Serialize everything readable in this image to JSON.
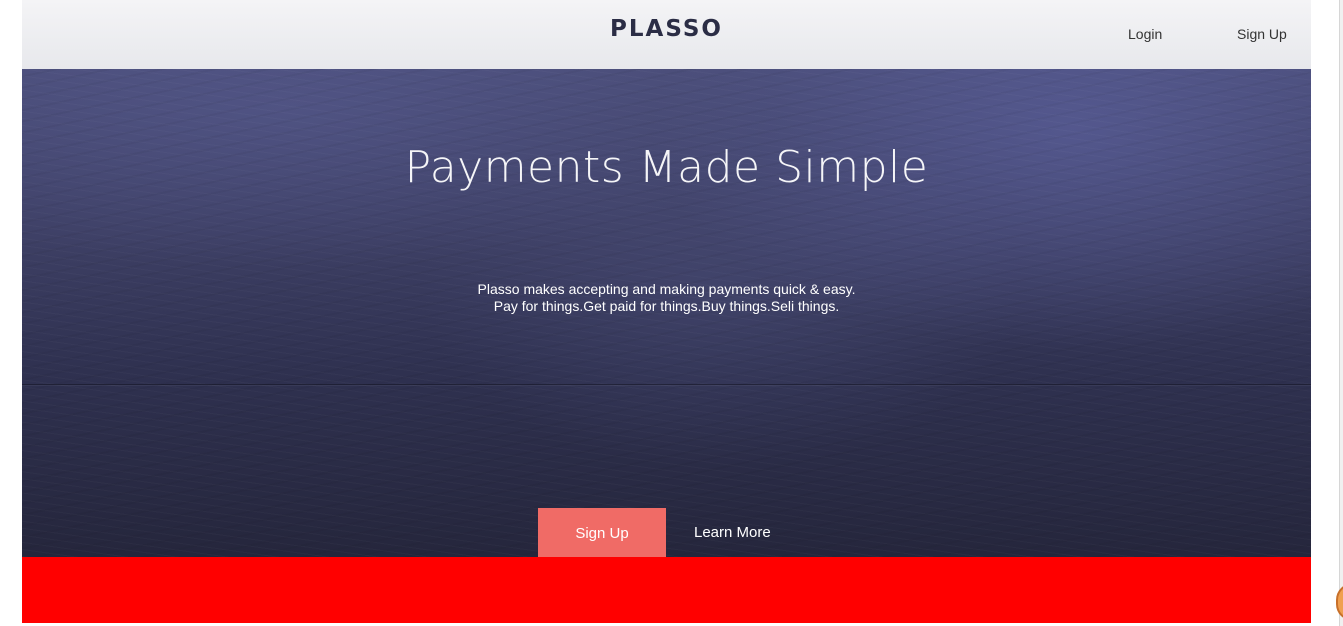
{
  "header": {
    "logo": "PLASSO",
    "nav": {
      "login": "Login",
      "signup": "Sign Up"
    }
  },
  "hero": {
    "title": "Payments Made Simple",
    "subtitle_line1": "Plasso makes accepting and making payments quick & easy.",
    "subtitle_line2": "Pay for things.Get paid for things.Buy things.Seli things.",
    "cta_signup": "Sign Up",
    "cta_learn_more": "Learn More"
  },
  "colors": {
    "header_bg": "#eeeef1",
    "logo": "#2b2d45",
    "hero_bg": "#35375a",
    "cta_signup_bg": "#f06b66",
    "band": "#ff0000"
  }
}
